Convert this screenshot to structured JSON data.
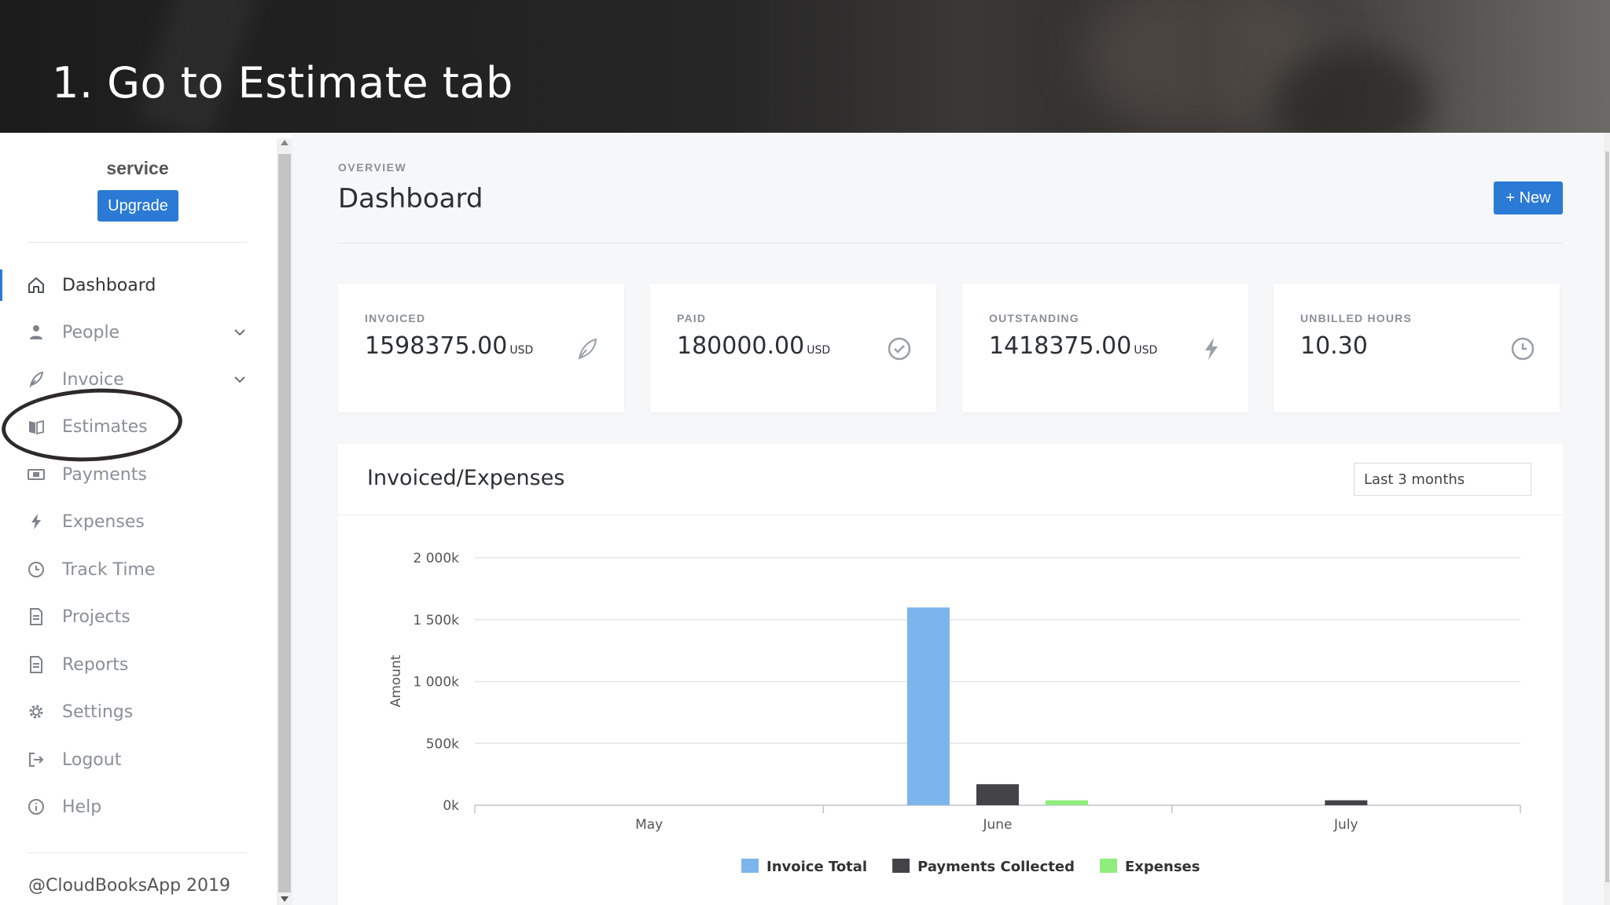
{
  "banner": {
    "title": "1. Go to Estimate tab"
  },
  "sidebar": {
    "org_name": "service",
    "upgrade_label": "Upgrade",
    "items": [
      {
        "label": "Dashboard",
        "icon": "home-icon",
        "active": true
      },
      {
        "label": "People",
        "icon": "person-icon",
        "has_chevron": true
      },
      {
        "label": "Invoice",
        "icon": "feather-icon",
        "has_chevron": true
      },
      {
        "label": "Estimates",
        "icon": "book-icon"
      },
      {
        "label": "Payments",
        "icon": "money-icon"
      },
      {
        "label": "Expenses",
        "icon": "bolt-icon"
      },
      {
        "label": "Track Time",
        "icon": "clock-icon"
      },
      {
        "label": "Projects",
        "icon": "document-icon"
      },
      {
        "label": "Reports",
        "icon": "document-icon"
      },
      {
        "label": "Settings",
        "icon": "gear-icon"
      },
      {
        "label": "Logout",
        "icon": "logout-icon"
      },
      {
        "label": "Help",
        "icon": "info-icon"
      }
    ],
    "copyright": "@CloudBooksApp 2019"
  },
  "main": {
    "overview_label": "OVERVIEW",
    "title": "Dashboard",
    "new_button_label": "+ New",
    "stats": [
      {
        "label": "INVOICED",
        "value": "1598375.00",
        "unit": "USD",
        "icon": "feather-icon"
      },
      {
        "label": "PAID",
        "value": "180000.00",
        "unit": "USD",
        "icon": "check-circle-icon"
      },
      {
        "label": "OUTSTANDING",
        "value": "1418375.00",
        "unit": "USD",
        "icon": "bolt-icon"
      },
      {
        "label": "UNBILLED HOURS",
        "value": "10.30",
        "unit": "",
        "icon": "clock-icon"
      }
    ],
    "chart_card": {
      "title": "Invoiced/Expenses",
      "range_select": "Last 3 months"
    }
  },
  "colors": {
    "accent": "#2a7ad6",
    "invoice_total": "#7cb5ec",
    "payments_collected": "#434348",
    "expenses": "#90ed7d"
  },
  "chart_data": {
    "type": "bar",
    "categories": [
      "May",
      "June",
      "July"
    ],
    "series": [
      {
        "name": "Invoice Total",
        "values": [
          0,
          1598375,
          0
        ]
      },
      {
        "name": "Payments Collected",
        "values": [
          0,
          170000,
          40000
        ]
      },
      {
        "name": "Expenses",
        "values": [
          0,
          40000,
          0
        ]
      }
    ],
    "ylabel": "Amount",
    "xlabel": "",
    "ylim": [
      0,
      2000000
    ],
    "yticks": [
      "0k",
      "500k",
      "1 000k",
      "1 500k",
      "2 000k"
    ],
    "grid": true,
    "legend": "bottom-center"
  }
}
